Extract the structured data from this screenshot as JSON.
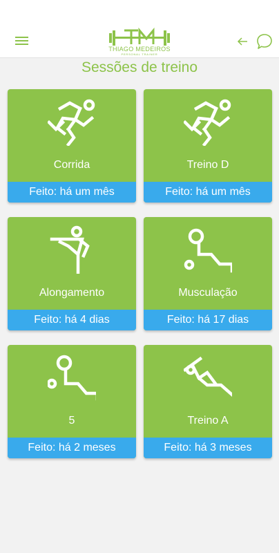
{
  "header": {
    "menu_icon": "hamburger-menu-icon",
    "logo_initials": "TM",
    "logo_name": "THIAGO MEDEIROS",
    "logo_subtitle": "PERSONAL TRAINER",
    "back_icon": "arrow-left-icon",
    "chat_icon": "chat-bubble-icon",
    "brand_color": "#8dc34a"
  },
  "page": {
    "title": "Sessões de treino"
  },
  "colors": {
    "card": "#8dc34a",
    "footer": "#39aaec",
    "background": "#f2f2f2"
  },
  "sessions": [
    {
      "label": "Corrida",
      "status": "Feito: há um mês",
      "icon": "running-icon"
    },
    {
      "label": "Treino D",
      "status": "Feito: há um mês",
      "icon": "running-icon"
    },
    {
      "label": "Alongamento",
      "status": "Feito: há 4 dias",
      "icon": "stretching-icon"
    },
    {
      "label": "Musculação",
      "status": "Feito: há 17 dias",
      "icon": "weightlifting-icon"
    },
    {
      "label": "5",
      "status": "Feito: há 2 meses",
      "icon": "weightlifting-icon"
    },
    {
      "label": "Treino A",
      "status": "Feito: há 3 meses",
      "icon": "situp-icon"
    }
  ]
}
